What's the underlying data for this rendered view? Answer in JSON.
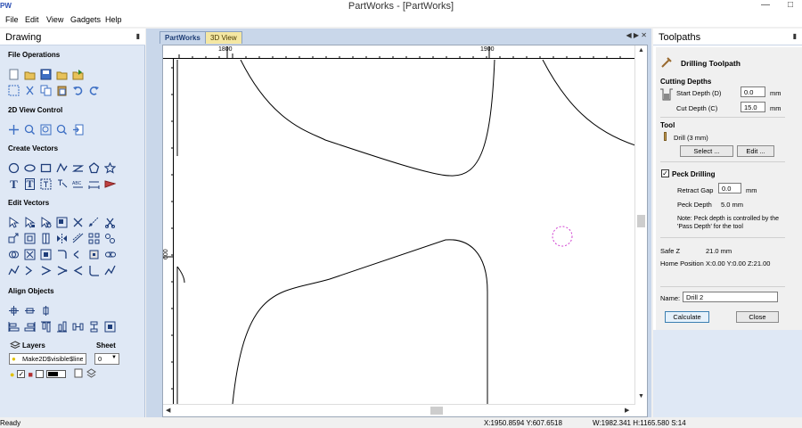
{
  "window": {
    "app_logo": "PW",
    "title": "PartWorks - [PartWorks]"
  },
  "menu": [
    "File",
    "Edit",
    "View",
    "Gadgets",
    "Help"
  ],
  "drawing_panel": {
    "title": "Drawing",
    "sections": {
      "file_operations": "File Operations",
      "view_control": "2D View Control",
      "create_vectors": "Create Vectors",
      "edit_vectors": "Edit Vectors",
      "align_objects": "Align Objects"
    },
    "layers": {
      "label": "Layers",
      "sheet_label": "Sheet",
      "layer_value": "Make2D$visible$lines",
      "sheet_value": "0"
    }
  },
  "tabs": {
    "partworks": "PartWorks",
    "view3d": "3D View"
  },
  "rulers": {
    "h1": "1800",
    "h2": "1900",
    "v1": "600"
  },
  "toolpaths": {
    "title": "Toolpaths",
    "heading": "Drilling Toolpath",
    "cutting_depths": "Cutting Depths",
    "start_depth_label": "Start Depth (D)",
    "start_depth_value": "0.0",
    "cut_depth_label": "Cut Depth (C)",
    "cut_depth_value": "15.0",
    "unit": "mm",
    "tool_label": "Tool",
    "tool_name": "Drill (3 mm)",
    "select_btn": "Select ...",
    "edit_btn": "Edit ...",
    "peck_label": "Peck Drilling",
    "retract_label": "Retract Gap",
    "retract_value": "0.0",
    "peck_depth_label": "Peck Depth",
    "peck_depth_value": "5.0 mm",
    "note_line1": "Note: Peck depth is controlled by the",
    "note_line2": "'Pass Depth' for the tool",
    "safe_z_label": "Safe Z",
    "safe_z_value": "21.0 mm",
    "home_label": "Home Position",
    "home_value": "X:0.00 Y:0.00 Z:21.00",
    "name_label": "Name:",
    "name_value": "Drill 2",
    "calculate_btn": "Calculate",
    "close_btn": "Close"
  },
  "status": {
    "ready": "Ready",
    "coords": "X:1950.8594 Y:607.6518",
    "dims": "W:1982.341  H:1165.580  S:14"
  }
}
